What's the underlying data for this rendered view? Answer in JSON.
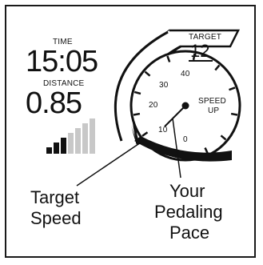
{
  "display": {
    "time_label": "TIME",
    "time_value": "15:05",
    "distance_label": "DISTANCE",
    "distance_value": "0.85",
    "target_label": "TARGET",
    "target_value": "12",
    "speed_up_line1": "SPEED",
    "speed_up_line2": "UP",
    "dial_numbers": [
      "0",
      "10",
      "20",
      "30",
      "40"
    ],
    "speed_bars": {
      "count": 7,
      "filled": 3
    }
  },
  "callouts": {
    "target_speed": [
      "Target",
      "Speed"
    ],
    "pedaling_pace": [
      "Your",
      "Pedaling",
      "Pace"
    ]
  },
  "colors": {
    "ink": "#111111",
    "bar_filled": "#111111",
    "bar_empty": "#c8c8c8",
    "background": "#ffffff"
  }
}
